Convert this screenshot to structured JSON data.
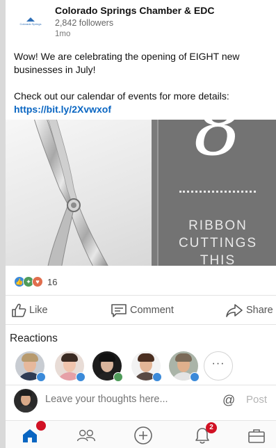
{
  "post": {
    "company_name": "Colorado Springs Chamber & EDC",
    "followers": "2,842 followers",
    "age": "1mo",
    "logo_text": "Colorado Springs",
    "text_line1": "Wow! We are celebrating the opening of EIGHT new businesses in July!",
    "text_line2": "Check out our calendar of events for more details:",
    "link": "https://bit.ly/2Xvwxof"
  },
  "image": {
    "number": "8",
    "caption_line1": "RIBBON",
    "caption_line2": "CUTTINGS",
    "caption_line3": "THIS"
  },
  "reactions_summary": {
    "count": "16",
    "icons": [
      "like-icon",
      "celebrate-icon",
      "love-icon"
    ]
  },
  "actions": {
    "like": "Like",
    "comment": "Comment",
    "share": "Share"
  },
  "reactions": {
    "title": "Reactions",
    "more_label": "···"
  },
  "comment_box": {
    "placeholder": "Leave your thoughts here...",
    "at_symbol": "@",
    "post_label": "Post"
  },
  "nav": {
    "notifications_badge": "2"
  },
  "colors": {
    "link": "#0a66c2",
    "like": "#3b8ad9",
    "celebrate": "#4f9b5a",
    "love": "#e06e4e",
    "badge": "#d11124",
    "home_active": "#0a66c2"
  }
}
